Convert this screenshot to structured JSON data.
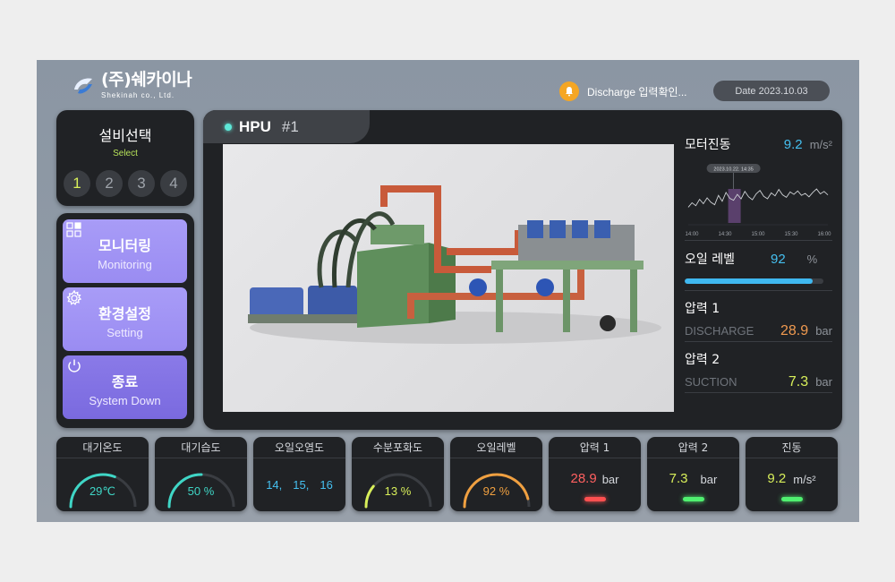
{
  "header": {
    "company_name": "(주)쉐카이나",
    "company_sub": "Shekinah co., Ltd.",
    "notification": "Discharge 입력확인...",
    "date_label": "Date",
    "date_value": "2023.10.03"
  },
  "equipment_select": {
    "title": "설비선택",
    "subtitle": "Select",
    "numbers": [
      "1",
      "2",
      "3",
      "4"
    ],
    "active": "1"
  },
  "menu": [
    {
      "label": "모니터링",
      "sub": "Monitoring",
      "icon": "monitoring-grid-icon"
    },
    {
      "label": "환경설정",
      "sub": "Setting",
      "icon": "gear-icon"
    },
    {
      "label": "종료",
      "sub": "System Down",
      "icon": "power-icon"
    }
  ],
  "main": {
    "title": "HPU",
    "unit_number": "#1",
    "motor_vibration": {
      "label": "모터진동",
      "value": "9.2",
      "unit": "m/s²"
    },
    "chart_data": {
      "type": "line",
      "tooltip": "2023.10.22. 14:35",
      "x_ticks": [
        "14:00",
        "14:30",
        "15:00",
        "15:30",
        "16:00"
      ],
      "values": [
        3.2,
        4.1,
        3.5,
        4.8,
        3.9,
        5.1,
        4.2,
        3.7,
        5.6,
        4.4,
        6.2,
        5.0,
        4.6,
        5.8,
        4.9,
        6.4,
        5.3,
        4.7,
        5.9,
        6.6,
        5.4,
        4.9,
        6.1,
        5.5,
        6.8,
        5.7,
        5.2,
        6.3,
        5.8,
        6.5,
        5.6,
        6.0,
        5.3,
        6.2,
        6.9,
        5.9,
        6.4,
        5.7
      ],
      "highlight_index": 12
    },
    "oil_level": {
      "label": "오일 레벨",
      "value": "92",
      "unit": "%",
      "fraction": 0.92
    },
    "pressure1": {
      "label": "압력 1",
      "name": "DISCHARGE",
      "value": "28.9",
      "unit": "bar"
    },
    "pressure2": {
      "label": "압력 2",
      "name": "SUCTION",
      "value": "7.3",
      "unit": "bar"
    }
  },
  "cards": {
    "temp": {
      "title": "대기온도",
      "value": "29",
      "unit": "℃",
      "fraction": 0.62,
      "color": "#3fd6c6"
    },
    "humidity": {
      "title": "대기습도",
      "value": "50",
      "unit": "%",
      "fraction": 0.5,
      "color": "#3fd6c6"
    },
    "contamination": {
      "title": "오일오염도",
      "values": [
        "14,",
        "15,",
        "16"
      ]
    },
    "water": {
      "title": "수분포화도",
      "value": "13",
      "unit": "%",
      "fraction": 0.22,
      "color": "#d8ef5a"
    },
    "oil": {
      "title": "오일레벨",
      "value": "92",
      "unit": "%",
      "fraction": 0.92,
      "color": "#f0a040"
    },
    "press1": {
      "title": "압력 1",
      "value": "28.9",
      "unit": "bar",
      "led": "#ff5050"
    },
    "press2": {
      "title": "압력 2",
      "value": "7.3",
      "unit": "bar",
      "led": "#50f070"
    },
    "vib": {
      "title": "진동",
      "value": "9.2",
      "unit": "m/s²",
      "led": "#50f070"
    }
  }
}
